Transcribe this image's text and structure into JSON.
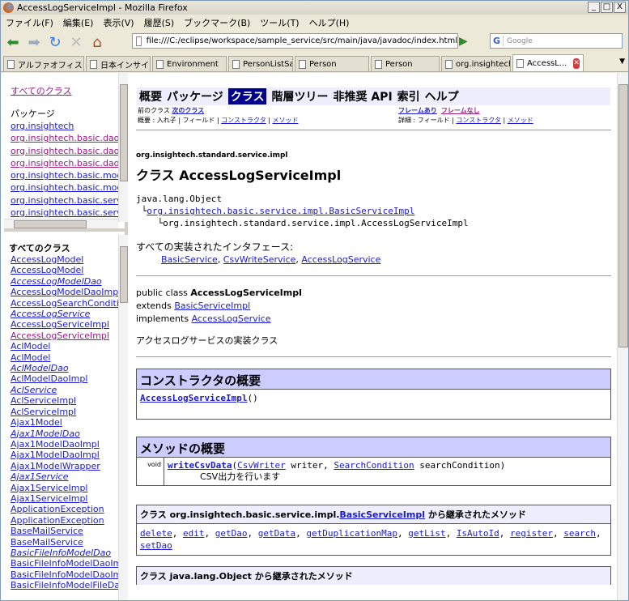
{
  "window": {
    "title": "AccessLogServiceImpl - Mozilla Firefox",
    "buttons": [
      "_",
      "□",
      "X"
    ]
  },
  "menu": [
    "ファイル(F)",
    "編集(E)",
    "表示(V)",
    "履歴(S)",
    "ブックマーク(B)",
    "ツール(T)",
    "ヘルプ(H)"
  ],
  "toolbar": {
    "url": "file:///C:/eclipse/workspace/sample_service/src/main/java/javadoc/index.html",
    "search_placeholder": "Google",
    "search_engine": "G"
  },
  "tabs": [
    {
      "label": "アルファオフィス"
    },
    {
      "label": "日本インサイト..."
    },
    {
      "label": "Environment"
    },
    {
      "label": "PersonListSa..."
    },
    {
      "label": "Person"
    },
    {
      "label": "Person"
    },
    {
      "label": "org.insightech..."
    },
    {
      "label": "AccessL..."
    }
  ],
  "left_top": {
    "all_classes": "すべてのクラス",
    "packages_label": "パッケージ",
    "packages": [
      "org.insightech",
      "org.insightech.basic.dao",
      "org.insightech.basic.dao.fi",
      "org.insightech.basic.dao.h",
      "org.insightech.basic.mode",
      "org.insightech.basic.mode",
      "org.insightech.basic.servic",
      "org.insightech.basic.servic"
    ]
  },
  "left_bottom": {
    "header": "すべてのクラス",
    "classes": [
      {
        "name": "AccessLogModel",
        "italic": false
      },
      {
        "name": "AccessLogModel",
        "italic": false
      },
      {
        "name": "AccessLogModelDao",
        "italic": true
      },
      {
        "name": "AccessLogModelDaoImpl",
        "italic": false
      },
      {
        "name": "AccessLogSearchConditio",
        "italic": false
      },
      {
        "name": "AccessLogService",
        "italic": true
      },
      {
        "name": "AccessLogServiceImpl",
        "italic": false
      },
      {
        "name": "AccessLogServiceImpl",
        "italic": false
      },
      {
        "name": "AclModel",
        "italic": false
      },
      {
        "name": "AclModel",
        "italic": false
      },
      {
        "name": "AclModelDao",
        "italic": true
      },
      {
        "name": "AclModelDaoImpl",
        "italic": false
      },
      {
        "name": "AclService",
        "italic": true
      },
      {
        "name": "AclServiceImpl",
        "italic": false
      },
      {
        "name": "AclServiceImpl",
        "italic": false
      },
      {
        "name": "Ajax1Model",
        "italic": false
      },
      {
        "name": "Ajax1ModelDao",
        "italic": true
      },
      {
        "name": "Ajax1ModelDaoImpl",
        "italic": false
      },
      {
        "name": "Ajax1ModelDaoImpl",
        "italic": false
      },
      {
        "name": "Ajax1ModelWrapper",
        "italic": false
      },
      {
        "name": "Ajax1Service",
        "italic": true
      },
      {
        "name": "Ajax1ServiceImpl",
        "italic": false
      },
      {
        "name": "Ajax1ServiceImpl",
        "italic": false
      },
      {
        "name": "ApplicationException",
        "italic": false
      },
      {
        "name": "ApplicationException",
        "italic": false
      },
      {
        "name": "BaseMailService",
        "italic": false
      },
      {
        "name": "BaseMailService",
        "italic": false
      },
      {
        "name": "BasicFileInfoModelDao",
        "italic": true
      },
      {
        "name": "BasicFileInfoModelDaoImp",
        "italic": false
      },
      {
        "name": "BasicFileInfoModelDaoImp",
        "italic": false
      },
      {
        "name": "BasicFileInfoModelFileDao",
        "italic": false
      }
    ]
  },
  "doc": {
    "nav": [
      "概要",
      "パッケージ",
      "クラス",
      "階層ツリー",
      "非推奨 API",
      "索引",
      "ヘルプ"
    ],
    "nav_selected": "クラス",
    "prev_class": "前のクラス",
    "next_class": "次のクラス",
    "frames": "フレームあり",
    "noframes": "フレームなし",
    "summary_prefix": "概要 : 入れ子 | フィールド | ",
    "summary_constructor": "コンストラクタ",
    "summary_method": "メソッド",
    "detail_prefix": "詳細 : フィールド | ",
    "detail_constructor": "コンストラクタ",
    "detail_method": "メソッド",
    "package": "org.insightech.standard.service.impl",
    "class_title": "クラス AccessLogServiceImpl",
    "inherit_root": "java.lang.Object",
    "inherit_parent": "org.insightech.basic.service.impl.BasicServiceImpl",
    "inherit_self": "org.insightech.standard.service.impl.AccessLogServiceImpl",
    "impl_heading": "すべての実装されたインタフェース:",
    "interfaces": [
      "BasicService",
      "CsvWriteService",
      "AccessLogService"
    ],
    "decl_public": "public class ",
    "decl_name": "AccessLogServiceImpl",
    "decl_extends": "extends ",
    "decl_extends_link": "BasicServiceImpl",
    "decl_implements": "implements ",
    "decl_implements_link": "AccessLogService",
    "description": "アクセスログサービスの実装クラス",
    "ctor_heading": "コンストラクタの概要",
    "ctor_link": "AccessLogServiceImpl",
    "ctor_suffix": "()",
    "method_heading": "メソッドの概要",
    "method_type": "void",
    "method_name": "writeCsvData",
    "method_param1_type": "CsvWriter",
    "method_param1": " writer, ",
    "method_param2_type": "SearchCondition",
    "method_param2": " searchCondition)",
    "method_desc": "CSV出力を行います",
    "inherited1_prefix": "クラス org.insightech.basic.service.impl.",
    "inherited1_link": "BasicServiceImpl",
    "inherited1_suffix": " から継承されたメソッド",
    "inherited1_methods": [
      "delete",
      "edit",
      "getDao",
      "getData",
      "getDuplicationMap",
      "getList",
      "IsAutoId",
      "register",
      "search",
      "setDao"
    ],
    "inherited2_heading": "クラス java.lang.Object から継承されたメソッド"
  }
}
